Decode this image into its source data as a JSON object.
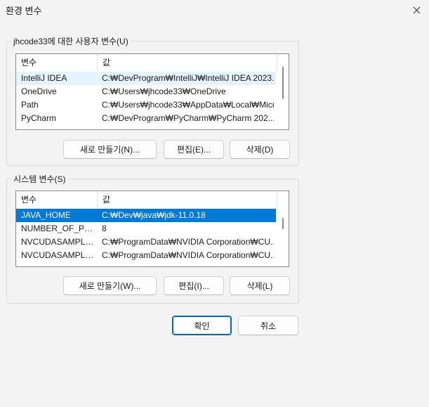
{
  "window": {
    "title": "환경 변수",
    "close_icon": "close-icon"
  },
  "user_vars": {
    "group_label": "jhcode33에 대한 사용자 변수(U)",
    "columns": [
      "변수",
      "값"
    ],
    "rows": [
      {
        "name": "IntelliJ IDEA",
        "value": "C:₩DevProgram₩IntelliJ₩IntelliJ IDEA 2023..."
      },
      {
        "name": "OneDrive",
        "value": "C:₩Users₩jhcode33₩OneDrive"
      },
      {
        "name": "Path",
        "value": "C:₩Users₩jhcode33₩AppData₩Local₩Micr..."
      },
      {
        "name": "PyCharm",
        "value": "C:₩DevProgram₩PyCharm₩PyCharm 202..."
      }
    ],
    "buttons": {
      "new": "새로 만들기(N)...",
      "edit": "편집(E)...",
      "delete": "삭제(D)"
    }
  },
  "system_vars": {
    "group_label": "시스템 변수(S)",
    "columns": [
      "변수",
      "값"
    ],
    "rows": [
      {
        "name": "JAVA_HOME",
        "value": "C:₩Dev₩java₩jdk-11.0.18",
        "selected": true
      },
      {
        "name": "NUMBER_OF_PRO...",
        "value": "8"
      },
      {
        "name": "NVCUDASAMPLE...",
        "value": "C:₩ProgramData₩NVIDIA Corporation₩CU..."
      },
      {
        "name": "NVCUDASAMPLE...",
        "value": "C:₩ProgramData₩NVIDIA Corporation₩CU..."
      }
    ],
    "buttons": {
      "new": "새로 만들기(W)...",
      "edit": "편집(I)...",
      "delete": "삭제(L)"
    }
  },
  "dialog_buttons": {
    "ok": "확인",
    "cancel": "취소"
  },
  "colors": {
    "selection": "#0078d7",
    "hover_row": "#e5f3ff",
    "primary_border": "#0067c0"
  }
}
